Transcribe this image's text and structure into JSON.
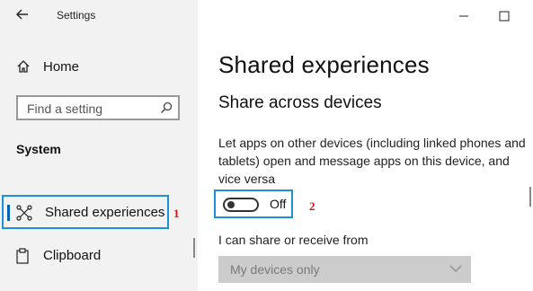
{
  "window": {
    "title": "Settings",
    "icons": {
      "back": "back-arrow-icon",
      "minimize": "minimize-icon",
      "maximize": "maximize-icon"
    }
  },
  "sidebar": {
    "home": {
      "label": "Home",
      "icon": "home-icon"
    },
    "search": {
      "placeholder": "Find a setting",
      "icon": "search-icon"
    },
    "section": "System",
    "items": [
      {
        "label": "Shared experiences",
        "icon": "shared-experiences-icon",
        "selected": true,
        "callout": "1"
      },
      {
        "label": "Clipboard",
        "icon": "clipboard-icon",
        "selected": false
      }
    ]
  },
  "main": {
    "title": "Shared experiences",
    "subtitle": "Share across devices",
    "description": "Let apps on other devices (including linked phones and tablets) open and message apps on this device, and vice versa",
    "toggle": {
      "state": "Off",
      "on": false,
      "callout": "2"
    },
    "share_from_label": "I can share or receive from",
    "share_from_dropdown": {
      "value": "My devices only",
      "enabled": false
    }
  },
  "colors": {
    "sidebar_bg": "#f2f2f2",
    "highlight_border": "#1e90d6",
    "accent": "#0063b1",
    "callout": "#d81010",
    "dropdown_disabled_bg": "#cccccc"
  }
}
